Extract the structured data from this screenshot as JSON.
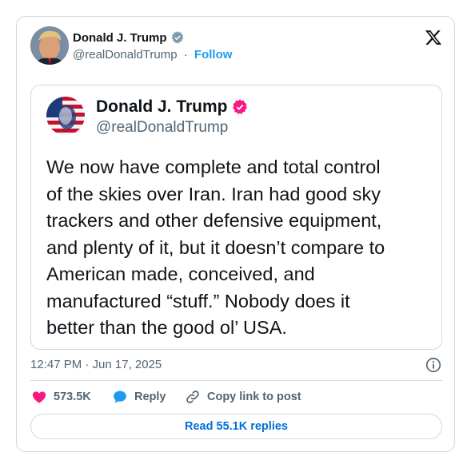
{
  "author": {
    "name": "Donald J. Trump",
    "handle": "@realDonaldTrump",
    "separator": "·",
    "follow_label": "Follow",
    "verified_color": "#829aab"
  },
  "quoted_post": {
    "name": "Donald J. Trump",
    "handle": "@realDonaldTrump",
    "verified_color": "#f91880",
    "text": "We now have complete and total control\nof the skies over Iran. Iran had good sky\ntrackers and other defensive equipment,\nand plenty of it, but it doesn’t compare to\nAmerican made, conceived, and\nmanufactured “stuff.” Nobody does it\nbetter than the good ol’ USA."
  },
  "meta": {
    "timestamp": "12:47 PM · Jun 17, 2025"
  },
  "actions": {
    "likes": "573.5K",
    "reply_label": "Reply",
    "copy_label": "Copy link to post"
  },
  "footer": {
    "read_replies_label": "Read 55.1K replies"
  },
  "icons": {
    "brand": "x-logo-icon",
    "like": "heart-icon",
    "reply": "speech-bubble-icon",
    "copy": "link-icon",
    "info": "info-icon"
  },
  "colors": {
    "like": "#f91880",
    "reply": "#1d9bf0",
    "link": "#1d9bf0",
    "muted": "#536471",
    "border": "#cfd9de"
  }
}
